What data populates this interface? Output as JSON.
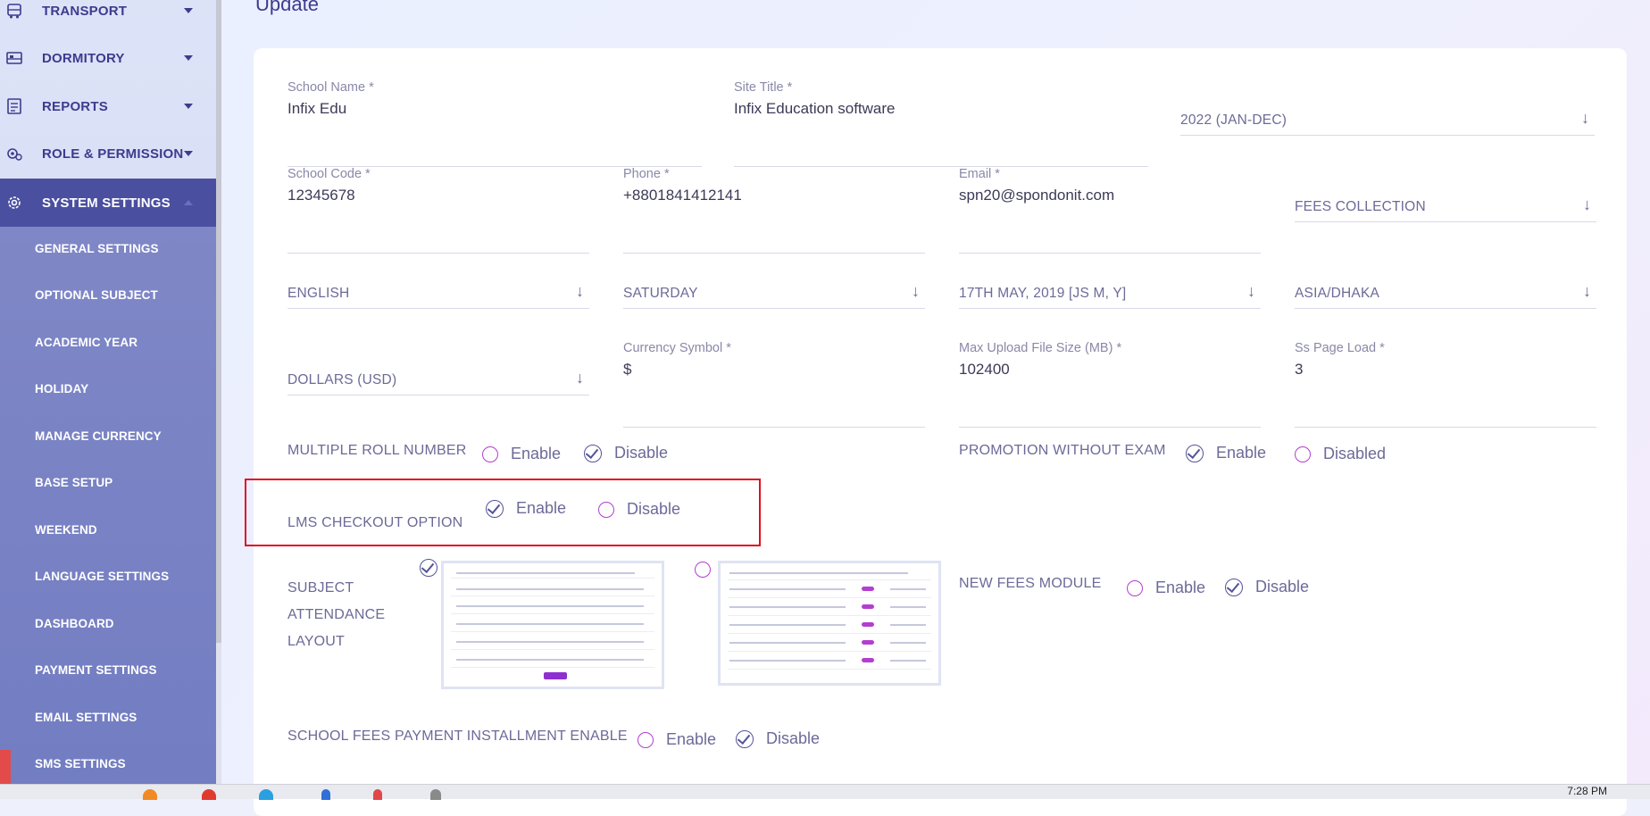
{
  "sidebar": {
    "menu": [
      {
        "label": "TRANSPORT",
        "icon": "bus-icon"
      },
      {
        "label": "DORMITORY",
        "icon": "bed-icon"
      },
      {
        "label": "REPORTS",
        "icon": "report-icon"
      },
      {
        "label": "ROLE & PERMISSION",
        "icon": "roles-gear-icon"
      },
      {
        "label": "SYSTEM SETTINGS",
        "icon": "settings-gear-icon",
        "active": true
      }
    ],
    "submenu": [
      "GENERAL SETTINGS",
      "OPTIONAL SUBJECT",
      "ACADEMIC YEAR",
      "HOLIDAY",
      "MANAGE CURRENCY",
      "BASE SETUP",
      "WEEKEND",
      "LANGUAGE SETTINGS",
      "DASHBOARD",
      "PAYMENT SETTINGS",
      "EMAIL SETTINGS",
      "SMS SETTINGS"
    ]
  },
  "page": {
    "title": "Update"
  },
  "form": {
    "school_name": {
      "label": "School Name *",
      "value": "Infix Edu"
    },
    "site_title": {
      "label": "Site Title *",
      "value": "Infix Education software"
    },
    "academic_session": {
      "value": "2022 (JAN-DEC)"
    },
    "school_code": {
      "label": "School Code *",
      "value": "12345678"
    },
    "phone": {
      "label": "Phone *",
      "value": "+8801841412141"
    },
    "email": {
      "label": "Email *",
      "value": "spn20@spondonit.com"
    },
    "fees_select": {
      "value": "FEES COLLECTION"
    },
    "language": {
      "value": "ENGLISH"
    },
    "week_start": {
      "value": "SATURDAY"
    },
    "date_format": {
      "value": "17TH MAY, 2019 [JS M, Y]"
    },
    "timezone": {
      "value": "ASIA/DHAKA"
    },
    "currency": {
      "value": "DOLLARS (USD)"
    },
    "currency_symbol": {
      "label": "Currency Symbol *",
      "value": "$"
    },
    "max_upload": {
      "label": "Max Upload File Size (MB) *",
      "value": "102400"
    },
    "ss_page_load": {
      "label": "Ss Page Load *",
      "value": "3"
    },
    "multiple_roll": {
      "label": "MULTIPLE ROLL NUMBER",
      "enable": "Enable",
      "disable": "Disable",
      "selected": "Disable"
    },
    "promotion": {
      "label": "PROMOTION WITHOUT EXAM",
      "enable": "Enable",
      "disable": "Disabled",
      "selected": "Enable"
    },
    "lms_checkout": {
      "label": "LMS CHECKOUT OPTION",
      "enable": "Enable",
      "disable": "Disable",
      "selected": "Enable"
    },
    "subject_attendance": {
      "label_lines": [
        "SUBJECT",
        "ATTENDANCE",
        "LAYOUT"
      ],
      "selected": "layout-1"
    },
    "new_fees": {
      "label": "NEW FEES MODULE",
      "enable": "Enable",
      "disable": "Disable",
      "selected": "Disable"
    },
    "installment": {
      "label": "SCHOOL FEES PAYMENT INSTALLMENT ENABLE",
      "enable": "Enable",
      "disable": "Disable",
      "selected": "Disable"
    }
  },
  "taskbar": {
    "clock": "7:28 PM"
  }
}
